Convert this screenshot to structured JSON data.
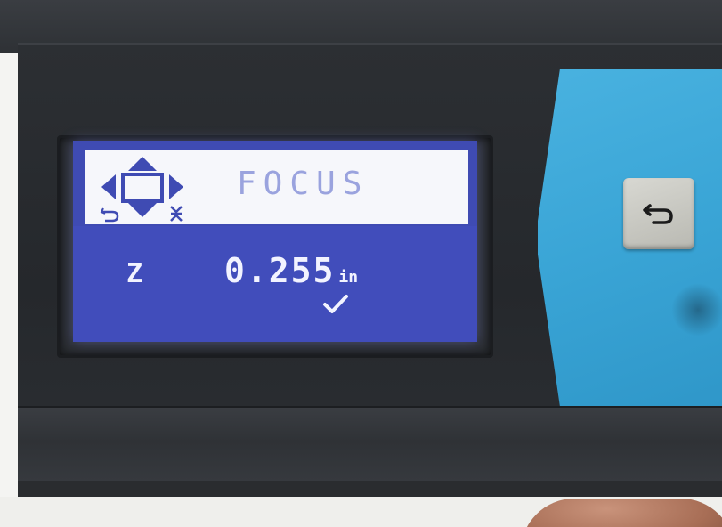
{
  "display": {
    "title": "FOCUS",
    "axis": "Z",
    "value": "0.255",
    "unit": "in"
  },
  "icons": {
    "nav": "directional-arrows-icon",
    "confirm": "checkmark-icon",
    "back": "return-arrow-icon"
  },
  "colors": {
    "lcd_background": "#414dbb",
    "lcd_header": "#f6f7fb",
    "title_text": "#9aa3de",
    "panel_blue": "#3aa5d6"
  }
}
